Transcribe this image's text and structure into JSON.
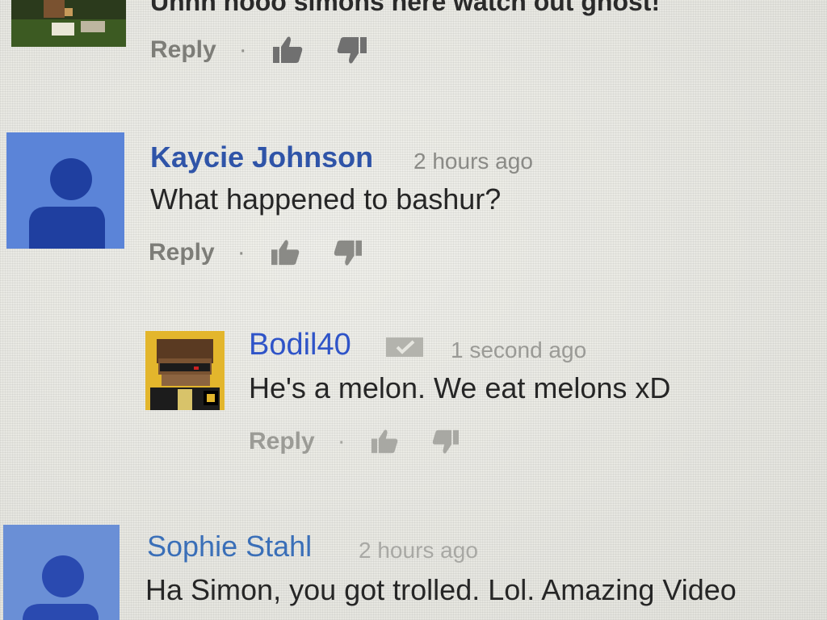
{
  "comments": [
    {
      "id": "top",
      "text": "Uhhh nooo simons here watch out ghost!",
      "reply_label": "Reply",
      "separator": "·"
    },
    {
      "id": "kaycie",
      "author": "Kaycie Johnson",
      "time": "2 hours ago",
      "text": "What happened to bashur?",
      "reply_label": "Reply",
      "separator": "·"
    },
    {
      "id": "bodil",
      "author": "Bodil40",
      "time": "1 second ago",
      "text": "He's a melon. We eat melons xD",
      "reply_label": "Reply",
      "separator": "·"
    },
    {
      "id": "sophie",
      "author": "Sophie Stahl",
      "time": "2 hours ago",
      "text": "Ha Simon, you got trolled. Lol. Amazing Video"
    }
  ],
  "colors": {
    "author": "#2f54a8",
    "avatar_default": "#5b84d8",
    "avatar_figure": "#1f3fa0",
    "text": "#262626",
    "meta": "#8a8a86"
  },
  "icons": {
    "like": "thumbs-up-icon",
    "dislike": "thumbs-down-icon",
    "verified": "check-badge-icon"
  }
}
